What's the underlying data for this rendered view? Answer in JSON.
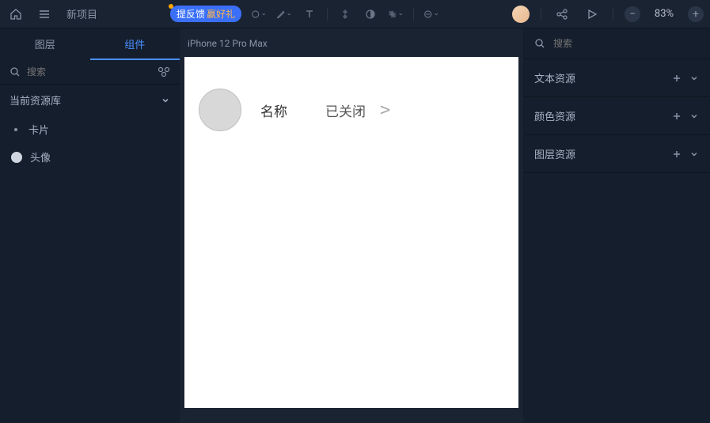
{
  "project": {
    "name": "新项目"
  },
  "feedback": {
    "text": "提反馈",
    "gift": "赢好礼"
  },
  "zoom": {
    "value": "83%"
  },
  "left_tabs": {
    "layers": "图层",
    "components": "组件"
  },
  "search": {
    "placeholder": "搜索"
  },
  "library": {
    "header": "当前资源库",
    "items": [
      {
        "label": "卡片",
        "type": "bullet"
      },
      {
        "label": "头像",
        "type": "circle"
      }
    ]
  },
  "canvas": {
    "device": "iPhone 12 Pro Max",
    "card": {
      "name": "名称",
      "status": "已关闭",
      "arrow": ">"
    }
  },
  "right": {
    "search_placeholder": "搜索",
    "sections": [
      {
        "label": "文本资源"
      },
      {
        "label": "颜色资源"
      },
      {
        "label": "图层资源"
      }
    ]
  }
}
